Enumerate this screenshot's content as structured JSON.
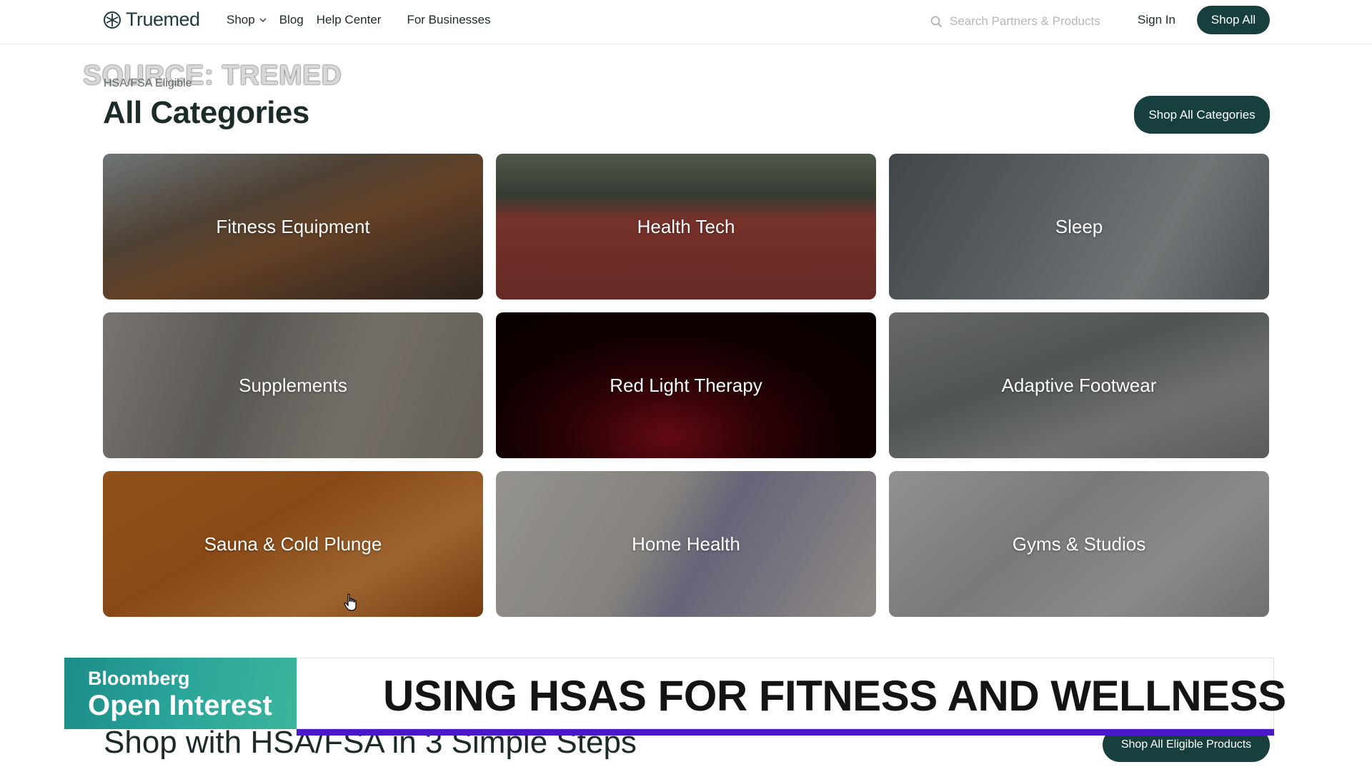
{
  "nav": {
    "logo_text": "Truemed",
    "links": {
      "shop": "Shop",
      "blog": "Blog",
      "help": "Help Center",
      "business": "For Businesses"
    },
    "search_placeholder": "Search Partners & Products",
    "sign_in": "Sign In",
    "shop_all": "Shop All"
  },
  "overlay": {
    "source": "SOURCE: TREMED"
  },
  "section": {
    "eyebrow": "HSA/FSA Eligible",
    "title": "All Categories",
    "button": "Shop All Categories"
  },
  "categories": [
    {
      "label": "Fitness Equipment"
    },
    {
      "label": "Health Tech"
    },
    {
      "label": "Sleep"
    },
    {
      "label": "Supplements"
    },
    {
      "label": "Red Light Therapy"
    },
    {
      "label": "Adaptive Footwear"
    },
    {
      "label": "Sauna & Cold Plunge"
    },
    {
      "label": "Home Health"
    },
    {
      "label": "Gyms & Studios"
    }
  ],
  "steps": {
    "title": "Shop with HSA/FSA in 3 Simple Steps",
    "button": "Shop All Eligible Products"
  },
  "lower_third": {
    "brand_line1": "Bloomberg",
    "brand_line2": "Open Interest",
    "headline": "USING HSAS FOR FITNESS AND WELLNESS"
  },
  "colors": {
    "primary_button": "#163f3d",
    "lower_third_accent": "#4a18c8",
    "brand_teal": "#2aa59a"
  }
}
